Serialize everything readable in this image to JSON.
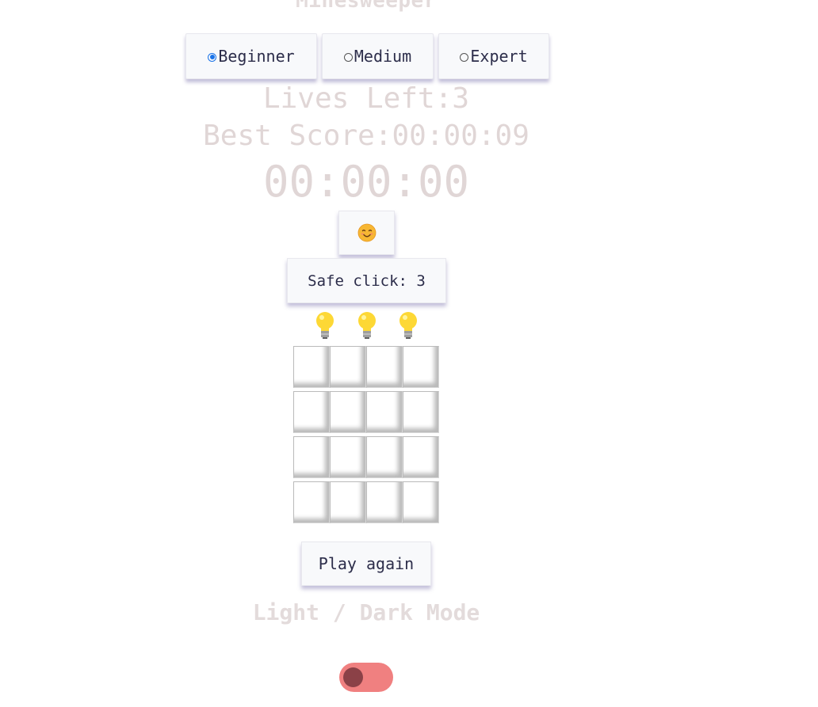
{
  "title": "Minesweeper",
  "levels": [
    {
      "label": "Beginner",
      "selected": true
    },
    {
      "label": "Medium",
      "selected": false
    },
    {
      "label": "Expert",
      "selected": false
    }
  ],
  "lives": {
    "text": "Lives Left:3"
  },
  "best_score": {
    "text": "Best Score:00:00:09"
  },
  "timer": {
    "text": "00:00:00"
  },
  "smiley": {
    "text": "😊"
  },
  "safe_click": {
    "label": "Safe click: 3"
  },
  "hints": {
    "count": 3,
    "icon": "lightbulb-icon"
  },
  "board": {
    "rows": 4,
    "cols": 4
  },
  "play_again": {
    "label": "Play again"
  },
  "mode": {
    "label": "Light / Dark Mode",
    "toggle_color": "#f08080",
    "knob_color": "#8b4147"
  },
  "colors": {
    "accent": "#1a73e8",
    "muted_text": "#e0d6d6",
    "button_text": "#2c2d4a"
  }
}
